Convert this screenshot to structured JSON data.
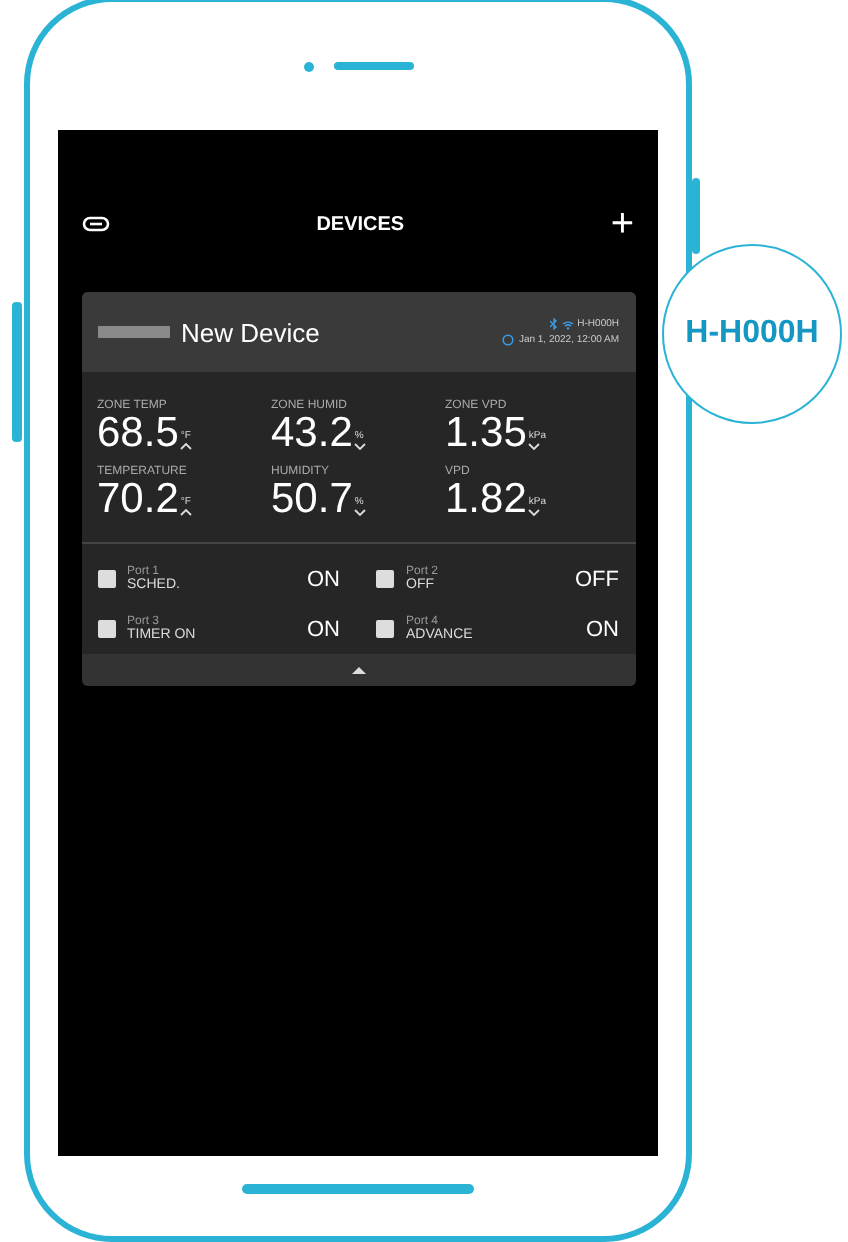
{
  "header": {
    "title": "DEVICES",
    "add": "+"
  },
  "device": {
    "name": "New Device",
    "id": "H-H000H",
    "date": "Jan 1, 2022, 12:00 AM"
  },
  "metrics": [
    {
      "label": "ZONE TEMP",
      "value": "68.5",
      "unit": "°F",
      "rising": true
    },
    {
      "label": "ZONE HUMID",
      "value": "43.2",
      "unit": "%",
      "rising": false
    },
    {
      "label": "ZONE VPD",
      "value": "1.35",
      "unit": "kPa",
      "rising": false
    },
    {
      "label": "TEMPERATURE",
      "value": "70.2",
      "unit": "°F",
      "rising": true
    },
    {
      "label": "HUMIDITY",
      "value": "50.7",
      "unit": "%",
      "rising": false
    },
    {
      "label": "VPD",
      "value": "1.82",
      "unit": "kPa",
      "rising": false
    }
  ],
  "ports": [
    {
      "name": "Port 1",
      "mode": "SCHED.",
      "state": "ON"
    },
    {
      "name": "Port 2",
      "mode": "OFF",
      "state": "OFF"
    },
    {
      "name": "Port 3",
      "mode": "TIMER ON",
      "state": "ON"
    },
    {
      "name": "Port 4",
      "mode": "ADVANCE",
      "state": "ON"
    }
  ],
  "callout": {
    "text": "H-H000H"
  }
}
